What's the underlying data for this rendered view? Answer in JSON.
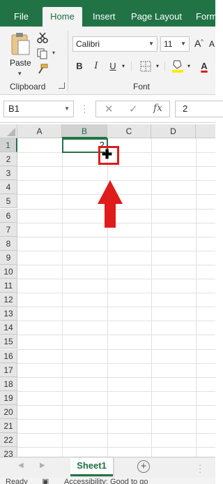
{
  "ribbon_tabs": {
    "file": "File",
    "home": "Home",
    "insert": "Insert",
    "page_layout": "Page Layout",
    "formulas": "Form"
  },
  "clipboard": {
    "paste_label": "Paste",
    "group_label": "Clipboard"
  },
  "font": {
    "name": "Calibri",
    "size": "11",
    "bold": "B",
    "italic": "I",
    "underline": "U",
    "grow_font": "A",
    "shrink_font": "A",
    "font_color": "A",
    "group_label": "Font"
  },
  "formula_bar": {
    "name_box": "B1",
    "fx": "fx",
    "value": "2"
  },
  "grid": {
    "columns": [
      "A",
      "B",
      "C",
      "D"
    ],
    "selected_column": "B",
    "rows": [
      "1",
      "2",
      "3",
      "4",
      "5",
      "6",
      "7",
      "8",
      "9",
      "10",
      "11",
      "12",
      "13",
      "14",
      "15",
      "16",
      "17",
      "18",
      "19",
      "20",
      "21",
      "22",
      "23"
    ],
    "selected_row": "1",
    "cells": {
      "B1": "2"
    }
  },
  "sheets": {
    "active": "Sheet1"
  },
  "status": {
    "ready": "Ready",
    "accessibility": "Accessibility: Good to go"
  },
  "colors": {
    "accent": "#217346",
    "highlight_red": "#e01b1b"
  }
}
